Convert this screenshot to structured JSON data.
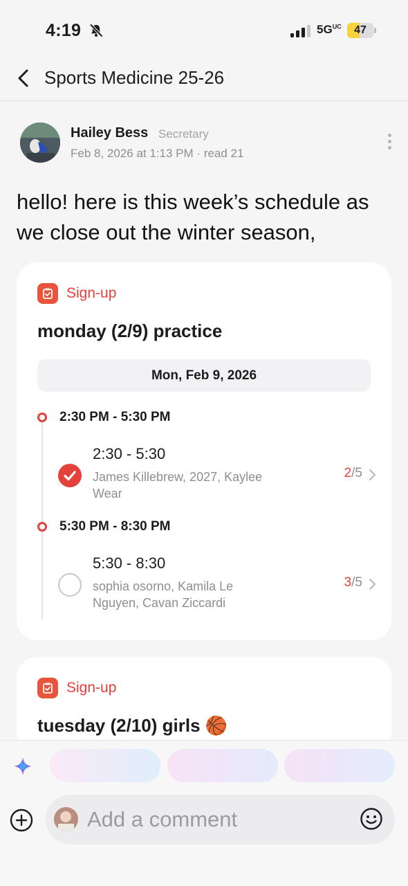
{
  "status_bar": {
    "time": "4:19",
    "network": "5G",
    "network_sup": "UC",
    "battery": "47",
    "battery_level": 0.47
  },
  "header": {
    "title": "Sports Medicine 25-26"
  },
  "post": {
    "author": "Hailey Bess",
    "role": "Secretary",
    "meta": "Feb 8, 2026 at 1:13 PM · read 21",
    "body": "hello! here is this week’s schedule as we close out the winter season,"
  },
  "signups": [
    {
      "tag": "Sign-up",
      "title": "monday (2/9) practice",
      "date": "Mon, Feb 9, 2026",
      "slots": [
        {
          "time": "2:30 PM - 5:30 PM",
          "shift_title": "2:30 - 5:30",
          "names": "James Killebrew, 2027, Kaylee Wear",
          "filled": "2",
          "total": "/5",
          "checked": true
        },
        {
          "time": "5:30 PM - 8:30 PM",
          "shift_title": "5:30 - 8:30",
          "names": "sophia osorno, Kamila Le Nguyen, Cavan Ziccardi",
          "filled": "3",
          "total": "/5",
          "checked": false
        }
      ]
    },
    {
      "tag": "Sign-up",
      "title": "tuesday (2/10) girls 🏀"
    }
  ],
  "composer": {
    "placeholder": "Add a comment"
  },
  "colors": {
    "accent": "#e5413b",
    "tag_icon": "#e8553d",
    "battery": "#f6d33c"
  },
  "icons": [
    "back-chevron-icon",
    "bell-slash-icon",
    "signal-icon",
    "more-vertical-icon",
    "clipboard-check-icon",
    "check-icon",
    "chevron-right-icon",
    "ai-sparkle-icon",
    "plus-circle-icon",
    "smiley-icon"
  ]
}
